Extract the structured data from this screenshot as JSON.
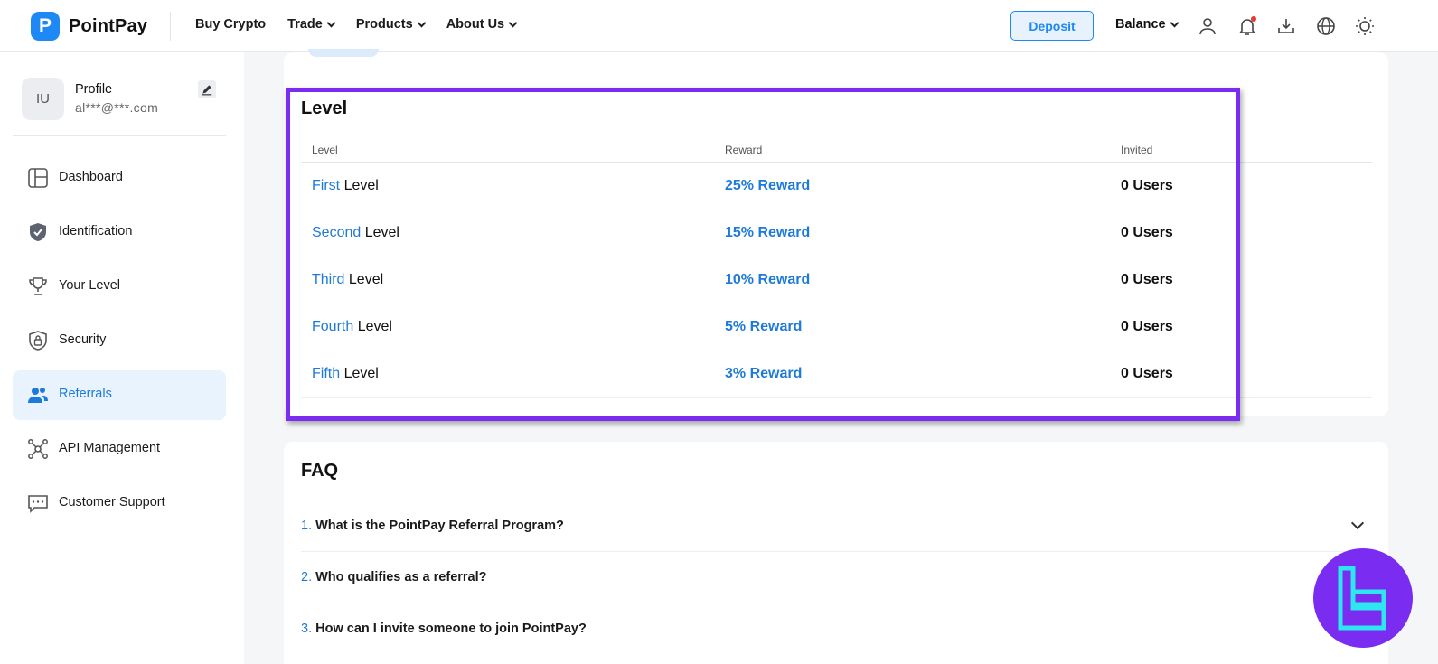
{
  "header": {
    "brand": "PointPay",
    "logo_letter": "P",
    "nav": [
      "Buy Crypto",
      "Trade",
      "Products",
      "About Us"
    ],
    "deposit_label": "Deposit",
    "balance_label": "Balance"
  },
  "profile": {
    "initials": "IU",
    "name": "Profile",
    "email": "al***@***.com"
  },
  "sidebar": {
    "items": [
      {
        "label": "Dashboard",
        "icon": "dashboard-icon"
      },
      {
        "label": "Identification",
        "icon": "shield-check-icon"
      },
      {
        "label": "Your Level",
        "icon": "trophy-icon"
      },
      {
        "label": "Security",
        "icon": "shield-lock-icon"
      },
      {
        "label": "Referrals",
        "icon": "users-icon",
        "active": true
      },
      {
        "label": "API Management",
        "icon": "network-icon"
      },
      {
        "label": "Customer Support",
        "icon": "chat-icon"
      }
    ]
  },
  "level": {
    "title": "Level",
    "columns": [
      "Level",
      "Reward",
      "Invited"
    ],
    "level_word": "Level",
    "rows": [
      {
        "ordinal": "First",
        "reward": "25% Reward",
        "invited": "0 Users"
      },
      {
        "ordinal": "Second",
        "reward": "15% Reward",
        "invited": "0 Users"
      },
      {
        "ordinal": "Third",
        "reward": "10% Reward",
        "invited": "0 Users"
      },
      {
        "ordinal": "Fourth",
        "reward": "5% Reward",
        "invited": "0 Users"
      },
      {
        "ordinal": "Fifth",
        "reward": "3% Reward",
        "invited": "0 Users"
      }
    ]
  },
  "faq": {
    "title": "FAQ",
    "items": [
      {
        "num": "1.",
        "question": "What is the PointPay Referral Program?"
      },
      {
        "num": "2.",
        "question": "Who qualifies as a referral?"
      },
      {
        "num": "3.",
        "question": "How can I invite someone to join PointPay?"
      }
    ]
  },
  "colors": {
    "accent": "#1e88f5",
    "highlight": "#7a2cf0",
    "active_bg": "#e9f3fd"
  }
}
